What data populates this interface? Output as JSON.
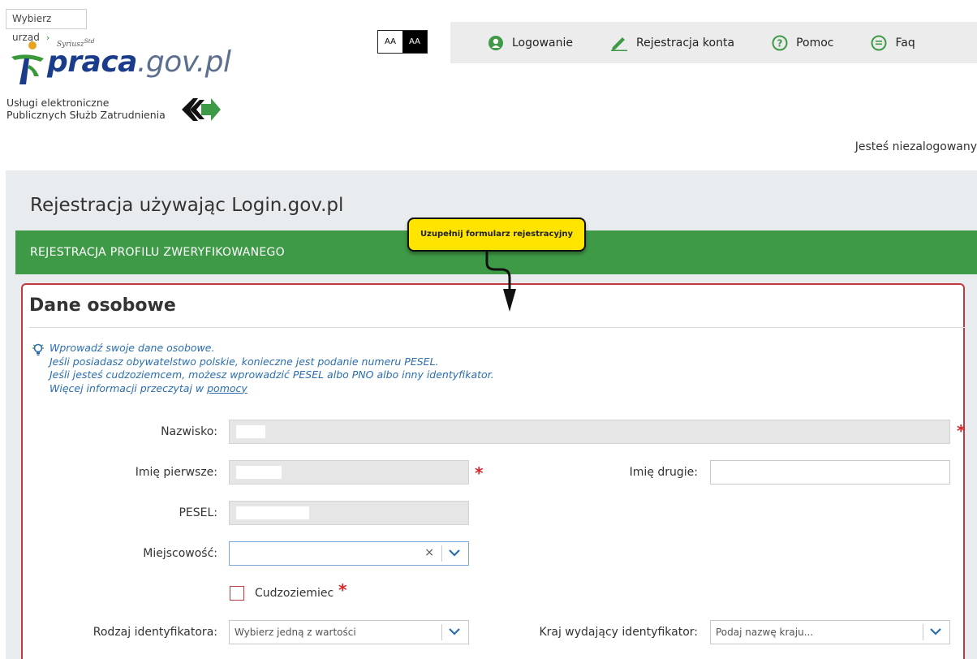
{
  "header": {
    "office_button": "Wybierz urząd",
    "office_chevron": "›",
    "logo_super": "Syriusz",
    "logo_super_sup": "Std",
    "logo_main": "praca",
    "logo_domain": ".gov.pl",
    "services_line1": "Usługi elektroniczne",
    "services_line2": "Publicznych Służb Zatrudnienia",
    "contrast_normal": "AA",
    "contrast_high": "AA"
  },
  "nav": {
    "items": [
      {
        "label": "Logowanie",
        "icon": "user-circle-icon"
      },
      {
        "label": "Rejestracja konta",
        "icon": "pencil-icon"
      },
      {
        "label": "Pomoc",
        "icon": "help-circle-icon"
      },
      {
        "label": "Faq",
        "icon": "chat-bubble-icon"
      }
    ]
  },
  "status": {
    "login": "Jesteś niezalogowany"
  },
  "page": {
    "title": "Rejestracja używając Login.gov.pl",
    "section_bar": "REJESTRACJA PROFILU ZWERYFIKOWANEGO"
  },
  "callout": {
    "text": "Uzupełnij formularz rejestracyjny"
  },
  "form": {
    "section_title": "Dane osobowe",
    "info_lines": [
      "Wprowadź swoje dane osobowe.",
      "Jeśli posiadasz obywatelstwo polskie, konieczne jest podanie numeru PESEL.",
      "Jeśli jesteś cudzoziemcem, możesz wprowadzić PESEL albo PNO albo inny identyfikator."
    ],
    "info_more_prefix": "Więcej informacji przeczytaj w ",
    "info_more_link": "pomocy",
    "labels": {
      "surname": "Nazwisko:",
      "first_name": "Imię pierwsze:",
      "second_name": "Imię drugie:",
      "pesel": "PESEL:",
      "city": "Miejscowość:",
      "foreigner": "Cudzoziemiec",
      "id_type": "Rodzaj identyfikatora:",
      "id_country": "Kraj wydający identyfikator:"
    },
    "placeholders": {
      "id_type": "Wybierz jedną z wartości",
      "id_country": "Podaj nazwę kraju..."
    },
    "required_mark": "*",
    "clear_mark": "×"
  },
  "colors": {
    "green_bar": "#3f9a47",
    "highlight_border": "#c4393f",
    "required": "#d8262c",
    "info_text": "#2a6db0",
    "callout": "#ffe400"
  }
}
